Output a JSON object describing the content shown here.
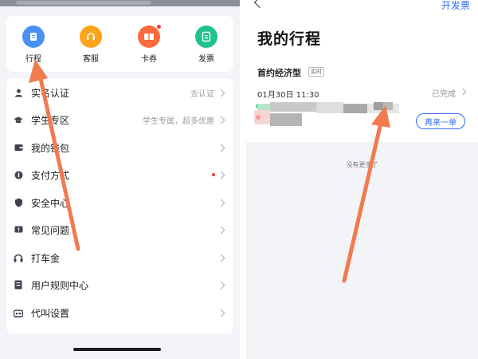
{
  "left": {
    "quick_actions": [
      {
        "label": "行程",
        "icon": "trip-icon",
        "color": "#4a90f5"
      },
      {
        "label": "客服",
        "icon": "headset-icon",
        "color": "#ffa31a"
      },
      {
        "label": "卡券",
        "icon": "ticket-icon",
        "color": "#ff6a3d",
        "badge": true
      },
      {
        "label": "发票",
        "icon": "invoice-icon",
        "color": "#21c28e"
      }
    ],
    "menu": [
      {
        "label": "实名认证",
        "value": "去认证",
        "icon": "person-icon"
      },
      {
        "label": "学生专区",
        "value": "学生专属，超多优惠",
        "icon": "graduation-cap-icon"
      },
      {
        "label": "我的钱包",
        "value": "",
        "icon": "wallet-icon"
      },
      {
        "label": "支付方式",
        "value": "",
        "icon": "payment-icon",
        "dot": true
      },
      {
        "label": "安全中心",
        "value": "",
        "icon": "shield-icon"
      },
      {
        "label": "常见问题",
        "value": "",
        "icon": "question-icon"
      },
      {
        "label": "打车金",
        "value": "",
        "icon": "headphones-icon"
      },
      {
        "label": "用户规则中心",
        "value": "",
        "icon": "rulebook-icon"
      },
      {
        "label": "代叫设置",
        "value": "",
        "icon": "car-call-icon"
      }
    ]
  },
  "right": {
    "invoice_link": "开发票",
    "title": "我的行程",
    "trip": {
      "type": "首约经济型",
      "tag": "实时",
      "time": "01月30日  11:30",
      "status": "已完成",
      "again_button": "再来一单"
    },
    "no_more": "没有更多了"
  },
  "colors": {
    "accent": "#2f6bff",
    "annotation_arrow": "#f27a4f",
    "badge_red": "#ff3b3b"
  }
}
